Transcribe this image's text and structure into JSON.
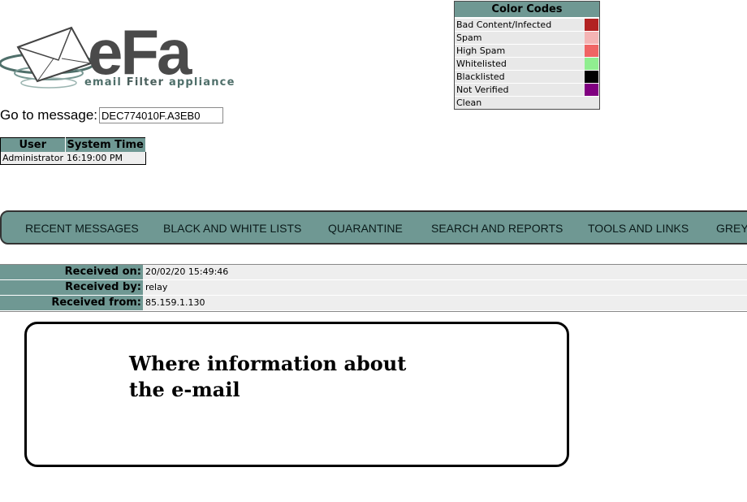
{
  "logo": {
    "brand": "eFa",
    "tagline_a": "email ",
    "tagline_b": "Filter",
    "tagline_c": " appliance"
  },
  "goto": {
    "label": "Go to message:",
    "value": "DEC774010F.A3EB0"
  },
  "user_table": {
    "headers": [
      "User",
      "System Time"
    ],
    "row": [
      "Administrator",
      "16:19:00 PM"
    ]
  },
  "color_codes": {
    "title": "Color Codes",
    "items": [
      {
        "label": "Bad Content/Infected",
        "color": "#b22222"
      },
      {
        "label": "Spam",
        "color": "#f4b4b4"
      },
      {
        "label": "High Spam",
        "color": "#f06464"
      },
      {
        "label": "Whitelisted",
        "color": "#90ee90"
      },
      {
        "label": "Blacklisted",
        "color": "#000000"
      },
      {
        "label": "Not Verified",
        "color": "#800080"
      },
      {
        "label": "Clean",
        "color": "#e8e8e8"
      }
    ]
  },
  "nav": {
    "items": [
      "RECENT MESSAGES",
      "BLACK AND WHITE LISTS",
      "QUARANTINE",
      "SEARCH AND REPORTS",
      "TOOLS AND LINKS",
      "GREY"
    ]
  },
  "details": {
    "received_on_label": "Received on:",
    "received_on_value": "20/02/20 15:49:46",
    "received_by_label": "Received by:",
    "received_by_value": "relay",
    "received_from_label": "Received from:",
    "received_from_value": "85.159.1.130"
  },
  "annotation": {
    "text": "Where information about the e-mail"
  },
  "colors": {
    "accent": "#6f9893",
    "row_bg": "#eeeeee"
  }
}
